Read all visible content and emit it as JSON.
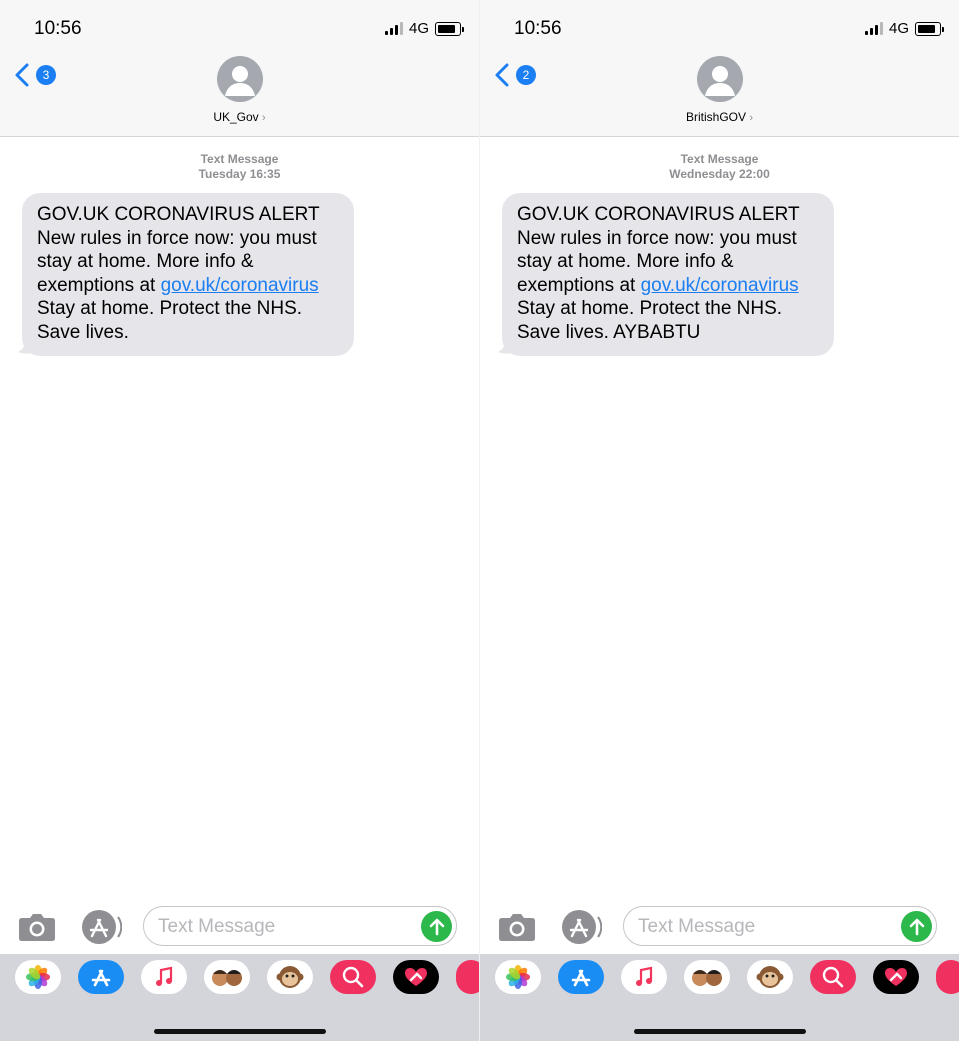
{
  "screens": [
    {
      "time": "10:56",
      "network": "4G",
      "back_count": "3",
      "contact_name": "UK_Gov",
      "contact_arrow": "›",
      "message_type": "Text Message",
      "timestamp": "Tuesday 16:35",
      "message": {
        "line1": "GOV.UK CORONAVIRUS ALERT",
        "line2": "New rules in force now: you must",
        "line3": "stay at home. More info &",
        "line4_prefix": "exemptions at ",
        "link": "gov.uk/coronavirus",
        "line5": "Stay at home. Protect the NHS.",
        "line6": "Save lives."
      },
      "input_placeholder": "Text Message"
    },
    {
      "time": "10:56",
      "network": "4G",
      "back_count": "2",
      "contact_name": "BritishGOV",
      "contact_arrow": "›",
      "message_type": "Text Message",
      "timestamp": "Wednesday 22:00",
      "message": {
        "line1": "GOV.UK CORONAVIRUS ALERT",
        "line2": "New rules in force now: you must",
        "line3": "stay at home. More info &",
        "line4_prefix": "exemptions at ",
        "link": "gov.uk/coronavirus",
        "line5": "Stay at home. Protect the NHS.",
        "line6": "Save lives. AYBABTU"
      },
      "input_placeholder": "Text Message"
    }
  ],
  "colors": {
    "accent": "#1b7ef2",
    "bubble": "#e5e5ea",
    "send": "#2cb84a",
    "drawer": "#d4d5db"
  },
  "drawer_icons": [
    "photos-icon",
    "app-store-icon",
    "music-icon",
    "memoji-icon",
    "monkey-animoji-icon",
    "image-search-icon",
    "digital-touch-icon",
    "partial-app-icon"
  ]
}
